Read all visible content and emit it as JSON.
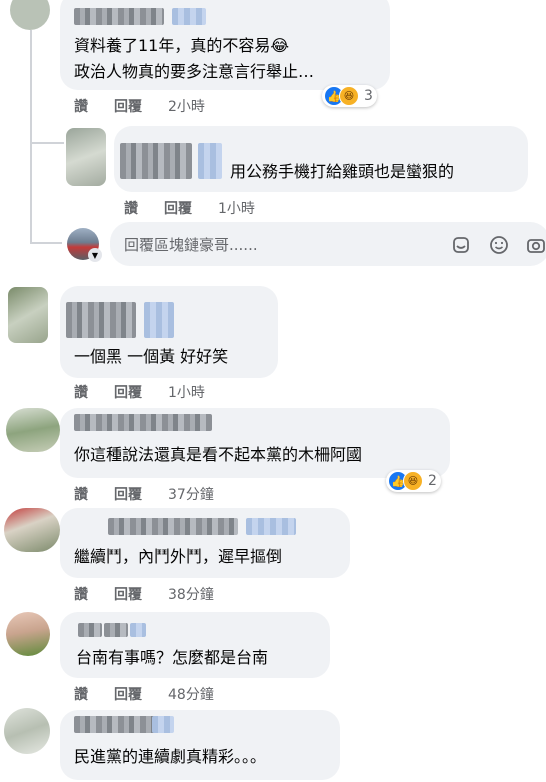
{
  "comments": [
    {
      "text_lines": [
        "資料養了11年，真的不容易😂",
        "政治人物真的要多注意言行舉止…"
      ],
      "actions": [
        "讚",
        "回覆"
      ],
      "time": "2小時",
      "reaction_count": "3"
    },
    {
      "text_lines": [
        "用公務手機打給雞頭也是蠻狠的"
      ],
      "actions": [
        "讚",
        "回覆"
      ],
      "time": "1小時",
      "is_reply": true
    },
    {
      "text_lines": [
        "一個黑 一個黃 好好笑"
      ],
      "actions": [
        "讚",
        "回覆"
      ],
      "time": "1小時"
    },
    {
      "text_lines": [
        "你這種說法還真是看不起本黨的木柵阿國"
      ],
      "actions": [
        "讚",
        "回覆"
      ],
      "time": "37分鐘",
      "reaction_count": "2"
    },
    {
      "text_lines": [
        "繼續鬥，內鬥外鬥，遲早摳倒"
      ],
      "actions": [
        "讚",
        "回覆"
      ],
      "time": "38分鐘"
    },
    {
      "text_lines": [
        "台南有事嗎？怎麼都是台南"
      ],
      "actions": [
        "讚",
        "回覆"
      ],
      "time": "48分鐘"
    },
    {
      "text_lines": [
        "民進黨的連續劇真精彩。。。"
      ]
    }
  ],
  "reply_input": {
    "placeholder": "回覆區塊鏈豪哥......",
    "icons": [
      "sticker-icon",
      "emoji-icon",
      "camera-icon"
    ]
  },
  "colors": {
    "bubble": "#f0f2f5",
    "meta": "#65676b",
    "like": "#1877f2",
    "haha": "#f7b125"
  }
}
